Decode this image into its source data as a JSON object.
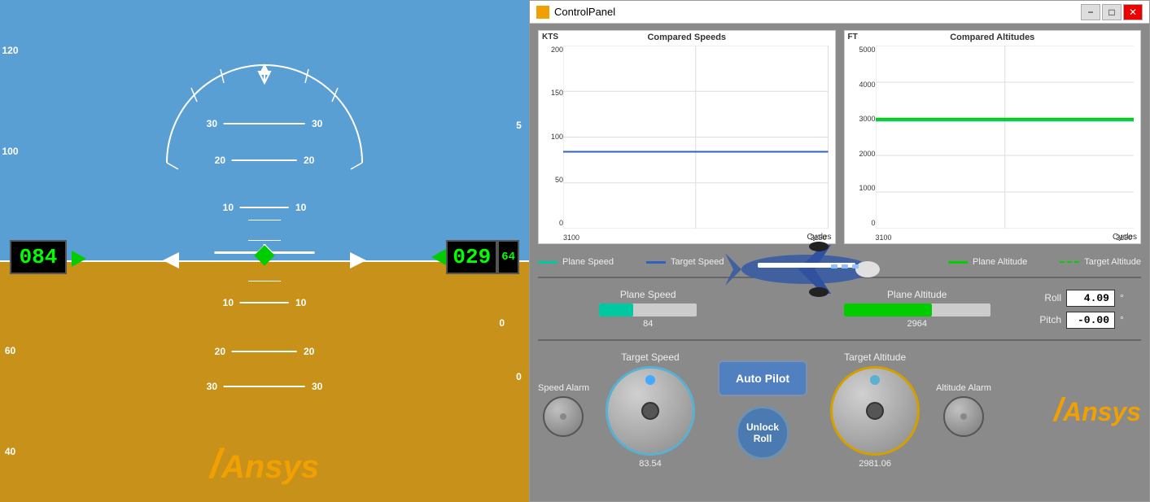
{
  "flight": {
    "speed": "084",
    "altitude_main": "029",
    "altitude_small": "64",
    "speed_scale": [
      "120",
      "100",
      "60",
      "40"
    ],
    "pitch_marks_above": [
      "30",
      "20",
      "10"
    ],
    "pitch_marks_below": [
      "10",
      "20",
      "30"
    ],
    "right_scale": [
      "5",
      "0"
    ],
    "ansys_label": "Ansys"
  },
  "control_panel": {
    "title": "ControlPanel",
    "charts": {
      "speed": {
        "title": "Compared Speeds",
        "y_label": "KTS",
        "x_label": "Cycles",
        "y_ticks": [
          "200",
          "150",
          "100",
          "50",
          "0"
        ],
        "x_ticks": [
          "3100",
          "3150"
        ],
        "plane_speed_value": 84,
        "target_speed_value": 84,
        "plane_speed_y_pct": 42,
        "target_speed_y_pct": 42
      },
      "altitude": {
        "title": "Compared Altitudes",
        "y_label": "FT",
        "x_label": "Cycles",
        "y_ticks": [
          "5000",
          "4000",
          "3000",
          "2000",
          "1000",
          "0"
        ],
        "x_ticks": [
          "3100",
          "3150"
        ],
        "plane_altitude_value": 2964,
        "target_altitude_value": 3000,
        "plane_altitude_y_pct": 59,
        "target_altitude_y_pct": 60
      }
    },
    "legend": {
      "left": [
        {
          "label": "Plane Speed",
          "color": "#00c8a0"
        },
        {
          "label": "Target Speed",
          "color": "#3060c0"
        }
      ],
      "right": [
        {
          "label": "Plane Altitude",
          "color": "#00c000"
        },
        {
          "label": "Target Altitude",
          "color": "#00c000"
        }
      ]
    },
    "plane_speed": {
      "label": "Plane Speed",
      "value": 84,
      "bar_pct": 35
    },
    "plane_altitude": {
      "label": "Plane Altitude",
      "value": 2964,
      "bar_pct": 60
    },
    "roll": {
      "label": "Roll",
      "value": "4.09",
      "unit": "°"
    },
    "pitch": {
      "label": "Pitch",
      "value": "-0.00",
      "unit": "°"
    },
    "speed_alarm": {
      "label": "Speed Alarm"
    },
    "target_speed": {
      "label": "Target Speed",
      "value": "83.54",
      "knob_dot_angle": 270
    },
    "autopilot": {
      "label": "Auto Pilot"
    },
    "unlock_roll": {
      "label": "Unlock Roll"
    },
    "target_altitude": {
      "label": "Target Altitude",
      "value": "2981.06",
      "knob_dot_angle": 90
    },
    "altitude_alarm": {
      "label": "Altitude Alarm"
    },
    "ansys_label": "Ansys"
  },
  "title_bar": {
    "minimize": "−",
    "maximize": "□",
    "close": "✕"
  }
}
